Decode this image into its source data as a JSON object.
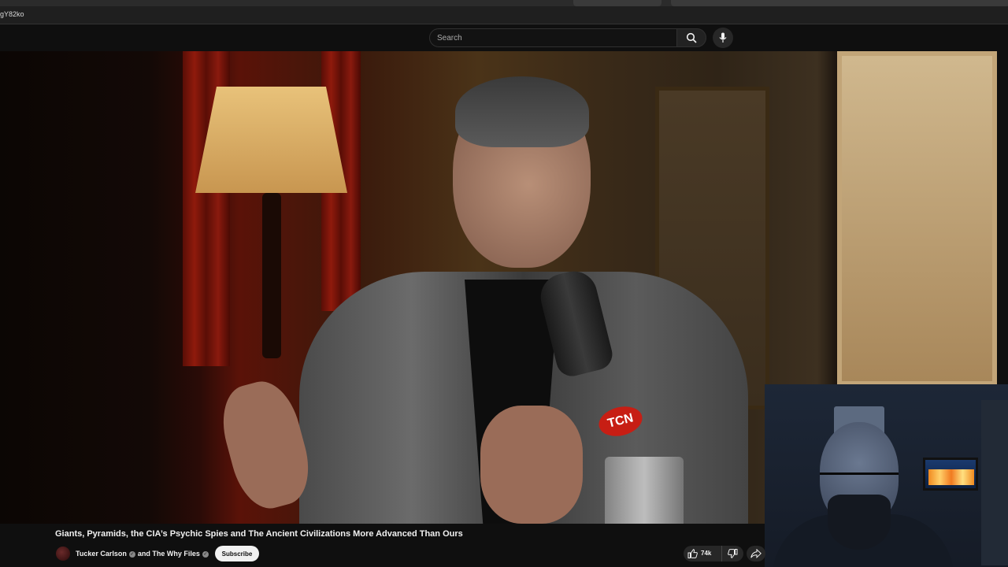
{
  "browser": {
    "url_fragment": "gY82ko"
  },
  "header": {
    "search_placeholder": "Search",
    "search_icon": "search-icon",
    "mic_icon": "microphone-icon"
  },
  "video": {
    "title": "Giants, Pyramids, the CIA’s Psychic Spies and The Ancient Civilizations More Advanced Than Ours",
    "mic_logo_text": "TCN"
  },
  "channel": {
    "name_primary": "Tucker Carlson",
    "and_text": "and",
    "name_secondary": "The Why Files",
    "subscribe_label": "Subscribe"
  },
  "actions": {
    "like_count": "74k",
    "like_icon": "thumbs-up-icon",
    "dislike_icon": "thumbs-down-icon",
    "share_icon": "share-icon"
  },
  "colors": {
    "background": "#0f0f0f",
    "text": "#f1f1f1",
    "subscribe_bg": "#f1f1f1",
    "pill_bg": "#272727",
    "mic_logo": "#c71e14"
  }
}
